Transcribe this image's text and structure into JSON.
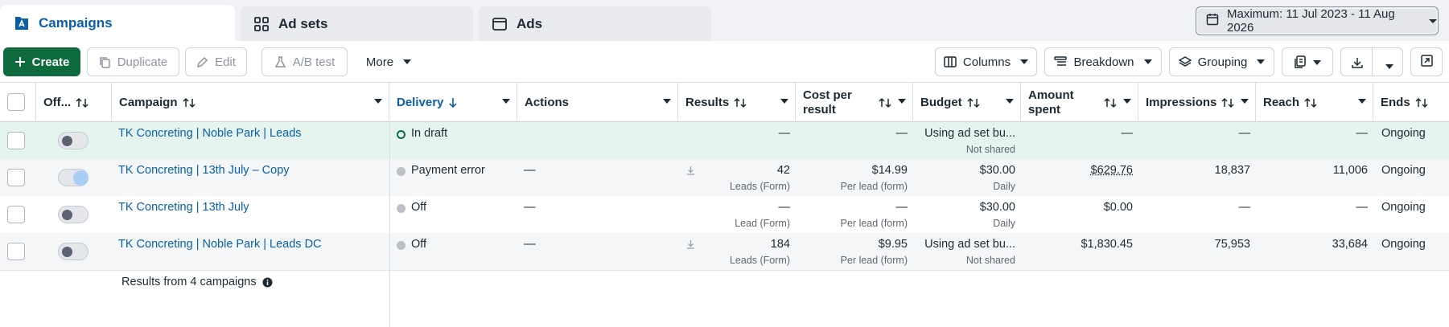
{
  "tabs": [
    {
      "label": "Campaigns",
      "icon": "campaigns-icon"
    },
    {
      "label": "Ad sets",
      "icon": "grid-icon"
    },
    {
      "label": "Ads",
      "icon": "ad-window-icon"
    }
  ],
  "date_range": {
    "label": "Maximum: 11 Jul 2023 - 11 Aug 2026",
    "icon": "calendar-icon"
  },
  "toolbar": {
    "create": "Create",
    "duplicate": "Duplicate",
    "edit": "Edit",
    "ab_test": "A/B test",
    "more": "More",
    "columns": "Columns",
    "breakdown": "Breakdown",
    "grouping": "Grouping"
  },
  "columns": {
    "off_on": "Off...",
    "campaign": "Campaign",
    "delivery": "Delivery",
    "actions": "Actions",
    "results": "Results",
    "cost_per_result_1": "Cost per",
    "cost_per_result_2": "result",
    "budget": "Budget",
    "amount_spent_1": "Amount",
    "amount_spent_2": "spent",
    "impressions": "Impressions",
    "reach": "Reach",
    "ends": "Ends"
  },
  "rows": [
    {
      "toggle_on": false,
      "campaign": "TK Concreting | Noble Park | Leads",
      "delivery": "In draft",
      "actions": "",
      "results": "—",
      "results_sub": "",
      "cost": "—",
      "cost_sub": "",
      "budget": "Using ad set bu...",
      "budget_sub": "Not shared",
      "spent": "—",
      "impressions": "—",
      "reach": "—",
      "ends": "Ongoing"
    },
    {
      "toggle_on": true,
      "campaign": "TK Concreting | 13th July – Copy",
      "delivery": "Payment error",
      "actions": "—",
      "results": "42",
      "results_sub": "Leads (Form)",
      "cost": "$14.99",
      "cost_sub": "Per lead (form)",
      "budget": "$30.00",
      "budget_sub": "Daily",
      "spent": "$629.76",
      "impressions": "18,837",
      "reach": "11,006",
      "ends": "Ongoing"
    },
    {
      "toggle_on": false,
      "campaign": "TK Concreting | 13th July",
      "delivery": "Off",
      "actions": "—",
      "results": "—",
      "results_sub": "Lead (Form)",
      "cost": "—",
      "cost_sub": "Per lead (form)",
      "budget": "$30.00",
      "budget_sub": "Daily",
      "spent": "$0.00",
      "impressions": "—",
      "reach": "—",
      "ends": "Ongoing"
    },
    {
      "toggle_on": false,
      "campaign": "TK Concreting | Noble Park | Leads DC",
      "delivery": "Off",
      "actions": "—",
      "results": "184",
      "results_sub": "Leads (Form)",
      "cost": "$9.95",
      "cost_sub": "Per lead (form)",
      "budget": "Using ad set bu...",
      "budget_sub": "Not shared",
      "spent": "$1,830.45",
      "impressions": "75,953",
      "reach": "33,684",
      "ends": "Ongoing"
    }
  ],
  "summary": "Results from 4 campaigns",
  "colors": {
    "accent": "#0a5fa8",
    "primary": "#0f6b3d",
    "draft_row": "#e6f4f0"
  }
}
